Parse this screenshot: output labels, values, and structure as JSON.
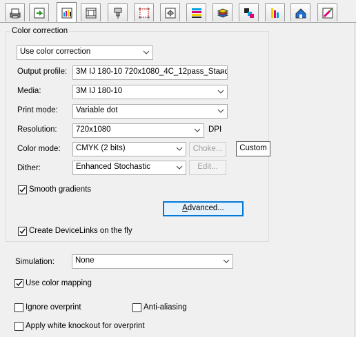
{
  "toolbar": {
    "tabs": [
      {
        "icon": "printer-settings-icon"
      },
      {
        "icon": "refresh-media-icon"
      },
      {
        "icon": "color-correction-icon",
        "active": true
      },
      {
        "icon": "film-frame-icon"
      },
      {
        "icon": "nozzle-icon"
      },
      {
        "icon": "crop-marks-icon"
      },
      {
        "icon": "registration-icon"
      },
      {
        "icon": "color-bars-icon"
      },
      {
        "icon": "layers-icon"
      },
      {
        "icon": "color-separation-icon"
      },
      {
        "icon": "cmyk-bars-icon"
      },
      {
        "icon": "house-label-icon"
      },
      {
        "icon": "color-picker-icon"
      }
    ]
  },
  "color_correction": {
    "group_title": "Color correction",
    "mode_value": "Use color correction",
    "output_profile_label": "Output profile:",
    "output_profile_value": "3M IJ 180-10 720x1080_4C_12pass_Stand",
    "media_label": "Media:",
    "media_value": "3M IJ 180-10",
    "print_mode_label": "Print mode:",
    "print_mode_value": "Variable dot",
    "resolution_label": "Resolution:",
    "resolution_value": "720x1080",
    "resolution_unit": "DPI",
    "color_mode_label": "Color mode:",
    "color_mode_value": "CMYK (2 bits)",
    "choke_label": "Choke...",
    "custom_label": "Custom",
    "dither_label": "Dither:",
    "dither_value": "Enhanced Stochastic",
    "edit_label": "Edit...",
    "smooth_gradients_label": "Smooth gradients",
    "smooth_gradients_checked": true,
    "advanced_label": "Advanced...",
    "devicelinks_label": "Create DeviceLinks on the fly",
    "devicelinks_checked": true
  },
  "simulation": {
    "label": "Simulation:",
    "value": "None"
  },
  "options": {
    "use_color_mapping_label": "Use color mapping",
    "use_color_mapping_checked": true,
    "ignore_overprint_label": "Ignore overprint",
    "ignore_overprint_checked": false,
    "anti_aliasing_label": "Anti-aliasing",
    "anti_aliasing_checked": false,
    "white_knockout_label": "Apply white knockout for overprint",
    "white_knockout_checked": false
  },
  "colors": {
    "accent": "#0078d7",
    "background": "#f0f0f0"
  }
}
